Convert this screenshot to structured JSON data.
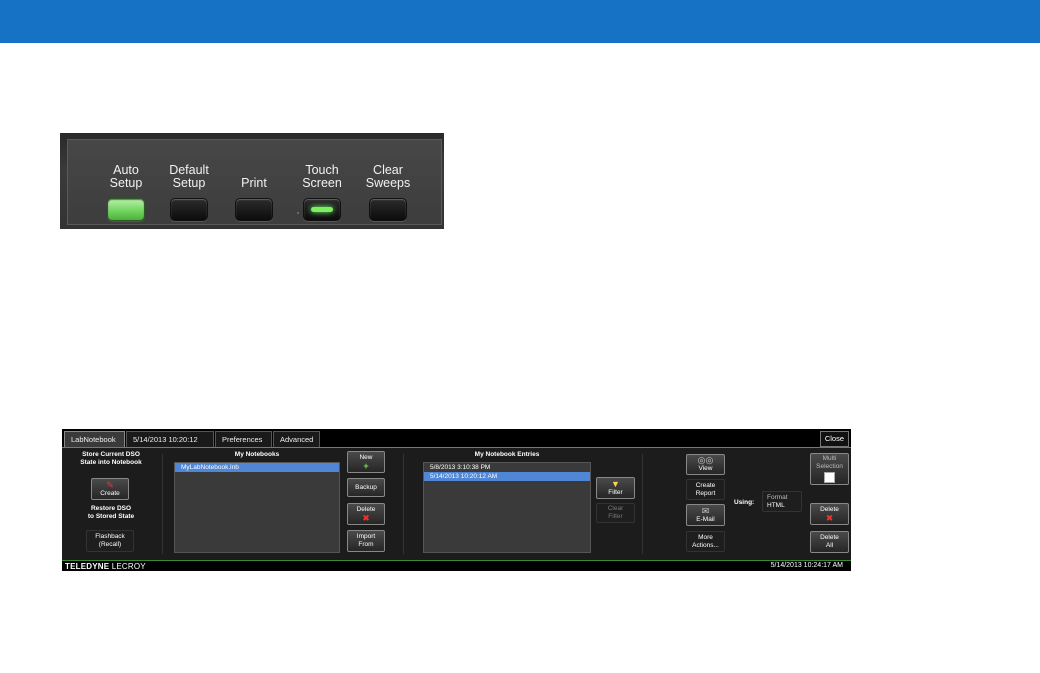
{
  "front_panel": {
    "buttons": [
      {
        "label_line1": "Auto",
        "label_line2": "Setup",
        "state": "lit"
      },
      {
        "label_line1": "Default",
        "label_line2": "Setup",
        "state": "off"
      },
      {
        "label_line1": "",
        "label_line2": "Print",
        "state": "off"
      },
      {
        "label_line1": "Touch",
        "label_line2": "Screen",
        "state": "touch"
      },
      {
        "label_line1": "Clear",
        "label_line2": "Sweeps",
        "state": "off"
      }
    ]
  },
  "dialog": {
    "tabs": [
      "LabNotebook",
      "5/14/2013 10:20:12 AM",
      "Preferences",
      "Advanced"
    ],
    "active_tab": "LabNotebook",
    "close_label": "Close",
    "store_header_l1": "Store Current DSO",
    "store_header_l2": "State into Notebook",
    "create_label": "Create",
    "restore_l1": "Restore DSO",
    "restore_l2": "to Stored State",
    "flashback_l1": "Flashback",
    "flashback_l2": "(Recall)",
    "notebooks_header": "My Notebooks",
    "notebooks": [
      "MyLabNotebook.lnb"
    ],
    "new_label": "New",
    "backup_label": "Backup",
    "delete_label": "Delete",
    "import_l1": "Import",
    "import_l2": "From",
    "entries_header": "My Notebook Entries",
    "entries": [
      "5/8/2013 3:10:38 PM",
      "5/14/2013 10:20:12 AM"
    ],
    "filter_label": "Filter",
    "clear_filter_l1": "Clear",
    "clear_filter_l2": "Filter",
    "view_label": "View",
    "create_report_l1": "Create",
    "create_report_l2": "Report",
    "email_label": "E-Mail",
    "more_actions_l1": "More",
    "more_actions_l2": "Actions...",
    "using_label": "Using:",
    "format_label": "Format",
    "format_value": "HTML",
    "multi_l1": "Multi",
    "multi_l2": "Selection",
    "delete2_label": "Delete",
    "delete_all_l1": "Delete",
    "delete_all_l2": "All",
    "brand_bold": "TELEDYNE",
    "brand_light": " LECROY",
    "clock": "5/14/2013 10:24:17 AM"
  },
  "colors": {
    "accent_bar": "#1572c4",
    "selection": "#4f86d6",
    "auto_setup_led": "#6dd35a"
  }
}
